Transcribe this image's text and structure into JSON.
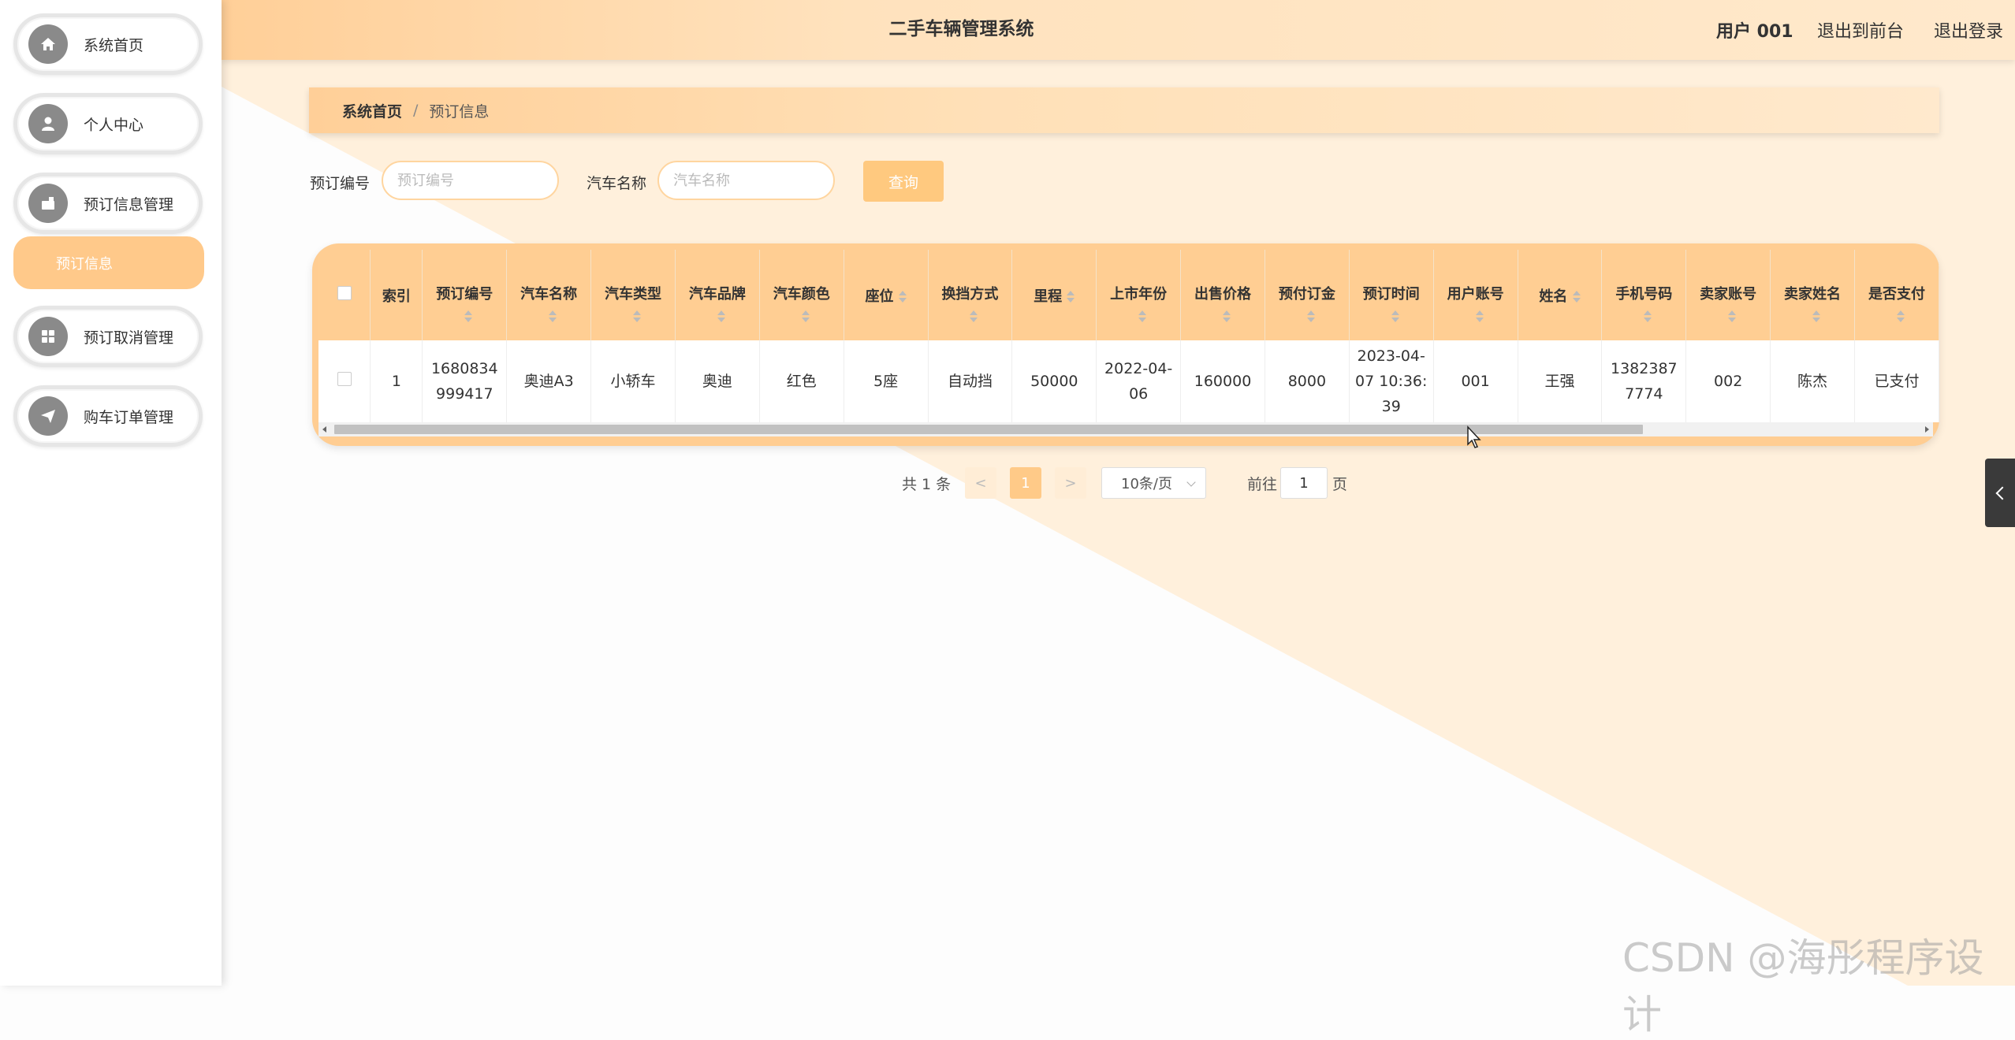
{
  "app": {
    "title": "二手车辆管理系统"
  },
  "header": {
    "user": "用户 001",
    "back_to_front": "退出到前台",
    "logout": "退出登录"
  },
  "sidebar": {
    "items": [
      {
        "label": "系统首页",
        "icon": "home-icon"
      },
      {
        "label": "个人中心",
        "icon": "user-icon"
      },
      {
        "label": "预订信息管理",
        "icon": "briefcase-icon"
      },
      {
        "label": "预订取消管理",
        "icon": "grid-icon"
      },
      {
        "label": "购车订单管理",
        "icon": "send-icon"
      }
    ],
    "submenu": {
      "label": "预订信息"
    }
  },
  "breadcrumb": {
    "home": "系统首页",
    "separator": "/",
    "current": "预订信息"
  },
  "search": {
    "order_no_label": "预订编号",
    "order_no_placeholder": "预订编号",
    "car_name_label": "汽车名称",
    "car_name_placeholder": "汽车名称",
    "query_button": "查询"
  },
  "table": {
    "columns": [
      "索引",
      "预订编号",
      "汽车名称",
      "汽车类型",
      "汽车品牌",
      "汽车颜色",
      "座位",
      "换挡方式",
      "里程",
      "上市年份",
      "出售价格",
      "预付订金",
      "预订时间",
      "用户账号",
      "姓名",
      "手机号码",
      "卖家账号",
      "卖家姓名",
      "是否支付"
    ],
    "rows": [
      [
        "1",
        "1680834999417",
        "奥迪A3",
        "小轿车",
        "奥迪",
        "红色",
        "5座",
        "自动挡",
        "50000",
        "2022-04-06",
        "160000",
        "8000",
        "2023-04-07 10:36:39",
        "001",
        "王强",
        "13823877774",
        "002",
        "陈杰",
        "已支付"
      ]
    ]
  },
  "pagination": {
    "total": "共 1 条",
    "prev": "<",
    "page": "1",
    "next": ">",
    "page_size": "10条/页",
    "goto_prefix": "前往",
    "goto_value": "1",
    "goto_suffix": "页"
  },
  "watermark": "CSDN @海彤程序设计",
  "colors": {
    "accent": "#ffc98a",
    "header_bg": "#ffcf98",
    "table_header": "#ffce93"
  }
}
